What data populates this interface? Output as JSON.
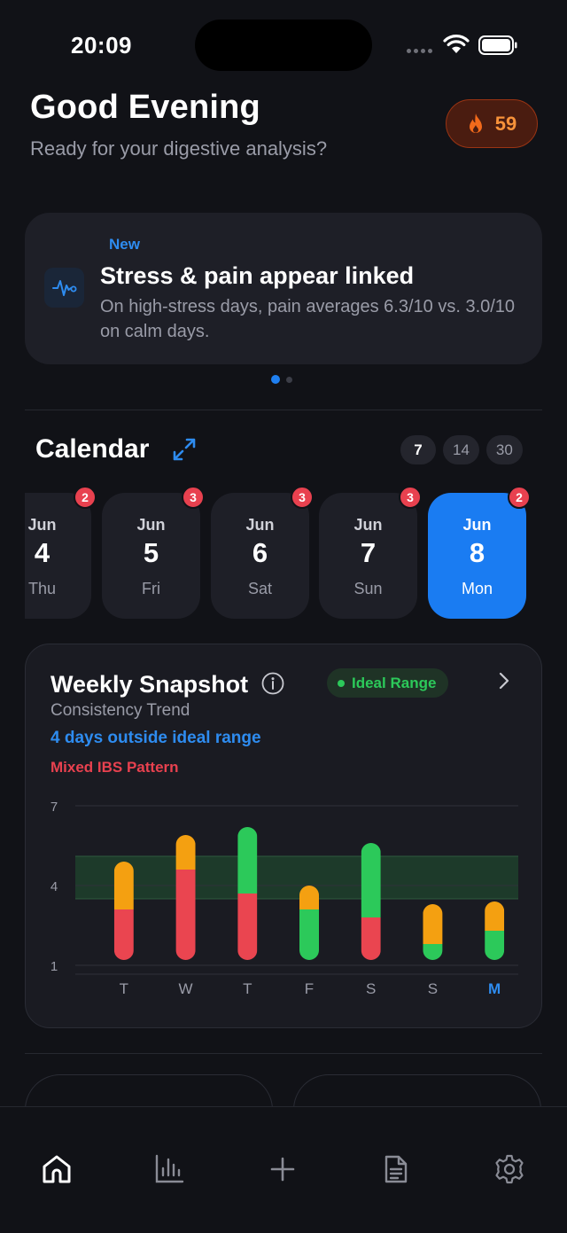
{
  "status_bar": {
    "time": "20:09"
  },
  "header": {
    "greeting": "Good Evening",
    "subtitle": "Ready for your digestive analysis?",
    "streak_count": "59",
    "streak_icon": "flame-icon",
    "streak_color": "#f7923a"
  },
  "insight": {
    "badge": "New",
    "title": "Stress & pain appear linked",
    "body": "On high-stress days, pain averages 6.3/10 vs. 3.0/10 on calm days.",
    "icon": "pulse-icon",
    "page_count": 2,
    "active_page": 0
  },
  "calendar": {
    "title": "Calendar",
    "ranges": [
      "7",
      "14",
      "30"
    ],
    "active_range": "7",
    "days": [
      {
        "month": "Jun",
        "day": "4",
        "weekday": "Thu",
        "count": "2",
        "selected": false
      },
      {
        "month": "Jun",
        "day": "5",
        "weekday": "Fri",
        "count": "3",
        "selected": false
      },
      {
        "month": "Jun",
        "day": "6",
        "weekday": "Sat",
        "count": "3",
        "selected": false
      },
      {
        "month": "Jun",
        "day": "7",
        "weekday": "Sun",
        "count": "3",
        "selected": false
      },
      {
        "month": "Jun",
        "day": "8",
        "weekday": "Mon",
        "count": "2",
        "selected": true
      }
    ]
  },
  "snapshot": {
    "title": "Weekly Snapshot",
    "status_label": "Ideal Range",
    "subtitle": "Consistency Trend",
    "outside_text": "4 days outside ideal range",
    "pattern_text": "Mixed IBS Pattern"
  },
  "chart_data": {
    "type": "bar",
    "stacked": true,
    "categories": [
      "T",
      "W",
      "T",
      "F",
      "S",
      "S",
      "M"
    ],
    "highlight_category_index": 6,
    "ylim": [
      1,
      7
    ],
    "yticks": [
      7,
      4,
      1
    ],
    "ideal_band": [
      3.5,
      5.1
    ],
    "series": [
      {
        "color": "#ea4550",
        "values": [
          [
            1.2,
            3.1
          ],
          [
            1.2,
            4.6
          ],
          [
            1.2,
            3.7
          ],
          null,
          [
            1.2,
            2.8
          ],
          null,
          null
        ]
      },
      {
        "color": "#2cc95a",
        "values": [
          null,
          null,
          [
            3.7,
            6.2
          ],
          [
            1.2,
            3.1
          ],
          [
            2.8,
            5.6
          ],
          [
            1.2,
            1.8
          ],
          [
            1.2,
            2.3
          ]
        ]
      },
      {
        "color": "#f4a011",
        "values": [
          [
            3.1,
            4.9
          ],
          [
            4.6,
            5.9
          ],
          null,
          [
            3.1,
            4.0
          ],
          null,
          [
            1.8,
            3.3
          ],
          [
            2.3,
            3.4
          ]
        ]
      }
    ],
    "colors": {
      "band": "#1d3a2a",
      "grid": "#30323b",
      "axis_text": "#9a9ca8",
      "highlight": "#2e8cf0"
    }
  },
  "tab_bar": {
    "items": [
      {
        "name": "home-icon",
        "active": true
      },
      {
        "name": "stats-icon",
        "active": false
      },
      {
        "name": "add-icon",
        "active": false
      },
      {
        "name": "report-icon",
        "active": false
      },
      {
        "name": "settings-icon",
        "active": false
      }
    ]
  }
}
